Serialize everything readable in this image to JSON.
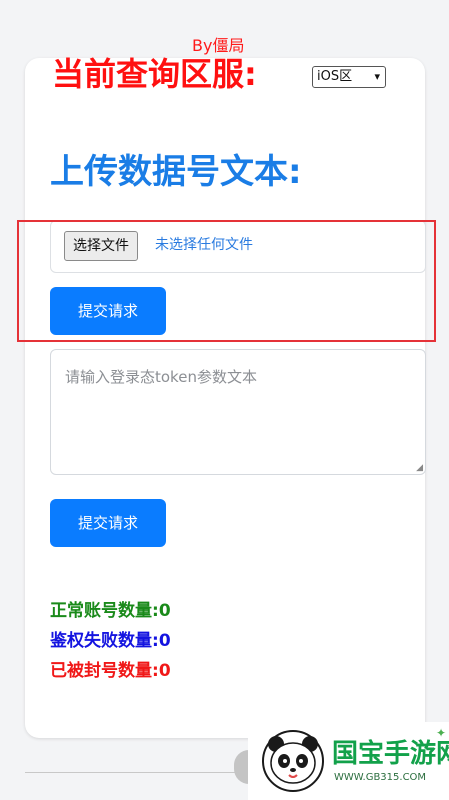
{
  "header": {
    "byline": "By僵局",
    "region_title": "当前查询区服:",
    "region_select": {
      "value": "iOS区",
      "icon": "chevron-down-icon"
    }
  },
  "upload": {
    "title": "上传数据号文本:",
    "file_button_label": "选择文件",
    "file_status": "未选择任何文件",
    "submit_label": "提交请求"
  },
  "token": {
    "placeholder": "请输入登录态token参数文本",
    "submit_label": "提交请求"
  },
  "stats": {
    "normal": {
      "label": "正常账号数量:",
      "value": "0",
      "color": "#1a8a1a"
    },
    "auth_failed": {
      "label": "鉴权失败数量:",
      "value": "0",
      "color": "#1414e0"
    },
    "banned": {
      "label": "已被封号数量:",
      "value": "0",
      "color": "#f01818"
    }
  },
  "watermark": {
    "title": "国宝手游网",
    "url": "WWW.GB315.COM"
  },
  "colors": {
    "accent_red": "#ff1010",
    "accent_blue": "#0a7cff",
    "highlight_box": "#e53238"
  }
}
